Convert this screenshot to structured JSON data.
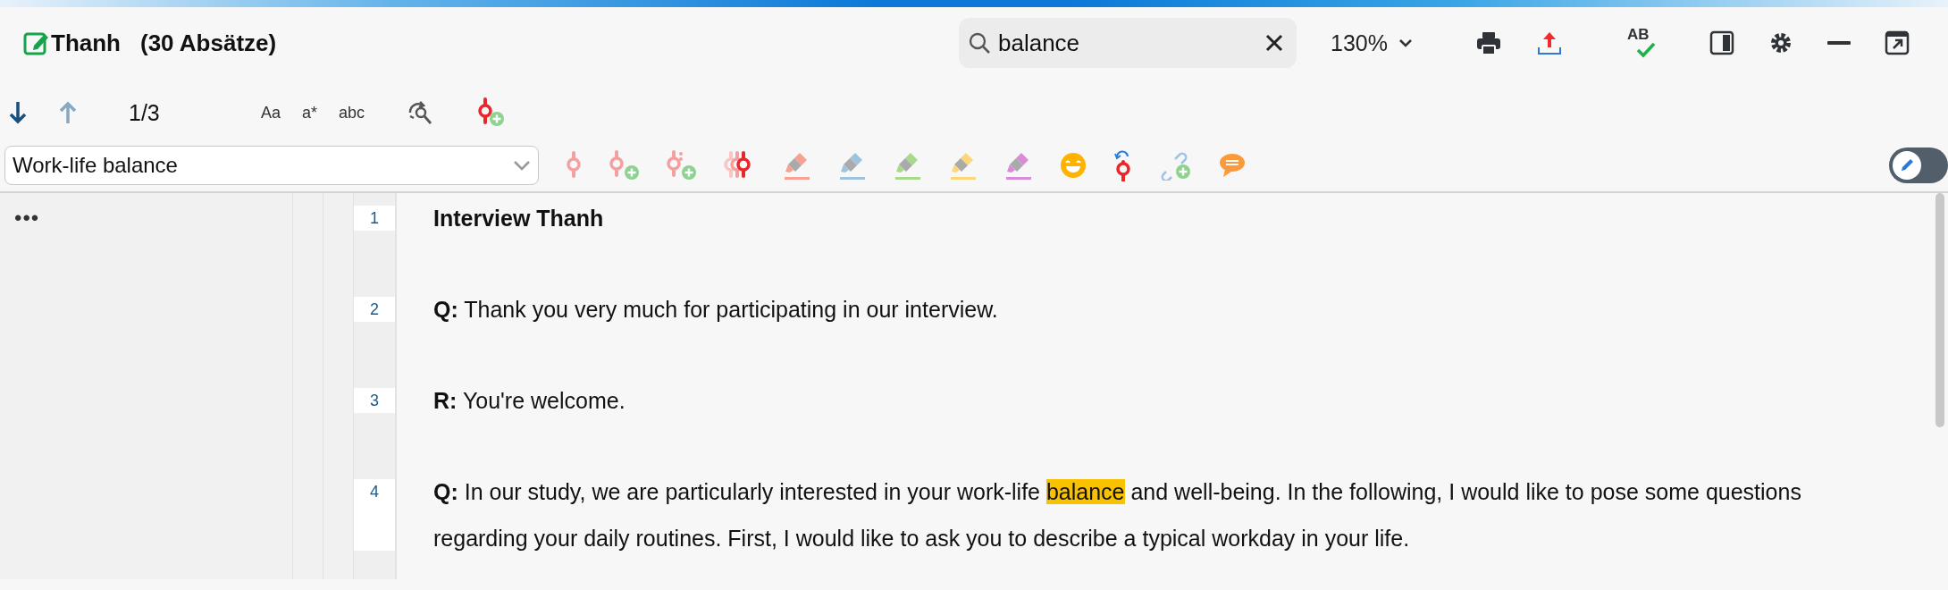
{
  "document": {
    "title": "Thanh",
    "paragraph_count": "(30 Absätze)"
  },
  "search": {
    "value": "balance"
  },
  "zoom": {
    "value": "130%"
  },
  "spellcheck": {
    "label": "AB"
  },
  "search_nav": {
    "counter": "1/3",
    "options": [
      "Aa",
      "a*",
      "abc"
    ]
  },
  "code_selector": {
    "value": "Work-life balance"
  },
  "edit_mode": {
    "on": false
  },
  "sidebar": {
    "menu": "•••"
  },
  "paragraphs": [
    {
      "number": "1",
      "kind": "heading",
      "segments": [
        {
          "text": "Interview Thanh",
          "highlight": false
        }
      ]
    },
    {
      "number": "2",
      "kind": "speech",
      "speaker": "Q:",
      "segments": [
        {
          "text": "Thank you very much for participating in our interview.",
          "highlight": false
        }
      ]
    },
    {
      "number": "3",
      "kind": "speech",
      "speaker": "R:",
      "segments": [
        {
          "text": "You're welcome.",
          "highlight": false
        }
      ]
    },
    {
      "number": "4",
      "kind": "speech",
      "speaker": "Q:",
      "segments": [
        {
          "text": " In our study, we are particularly interested in your work-life ",
          "highlight": false
        },
        {
          "text": "balance",
          "highlight": true
        },
        {
          "text": " and well-being. In the following, I would like to pose some questions regarding your daily routines. First, I would like to ask you to describe a typical workday in your life.",
          "highlight": false
        }
      ]
    }
  ]
}
